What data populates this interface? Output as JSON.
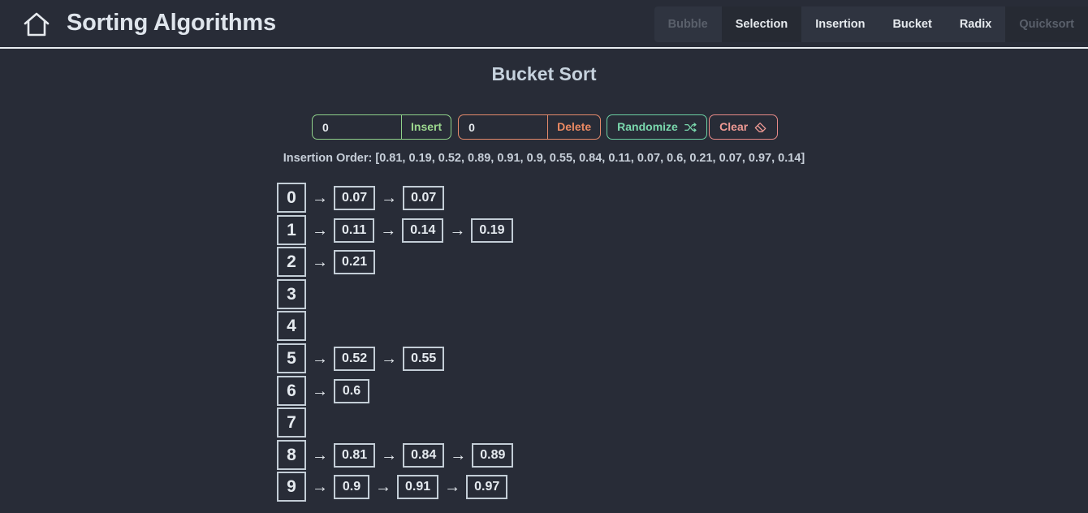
{
  "header": {
    "title": "Sorting Algorithms",
    "home_icon": "home-icon",
    "nav": [
      {
        "label": "Bubble",
        "state": "disabled"
      },
      {
        "label": "Selection",
        "state": "normal"
      },
      {
        "label": "Insertion",
        "state": "normal"
      },
      {
        "label": "Bucket",
        "state": "normal"
      },
      {
        "label": "Radix",
        "state": "normal"
      },
      {
        "label": "Quicksort",
        "state": "disabled"
      }
    ]
  },
  "main": {
    "heading": "Bucket Sort",
    "insert": {
      "value": "0",
      "label": "Insert"
    },
    "delete": {
      "value": "0",
      "label": "Delete"
    },
    "randomize": {
      "label": "Randomize",
      "icon": "shuffle-icon"
    },
    "clear": {
      "label": "Clear",
      "icon": "eraser-icon"
    },
    "insertion_order": {
      "label": "Insertion Order:",
      "values": "[0.81, 0.19, 0.52, 0.89, 0.91, 0.9, 0.55, 0.84, 0.11, 0.07, 0.6, 0.21, 0.07, 0.97, 0.14]"
    },
    "buckets": [
      {
        "index": "0",
        "items": [
          "0.07",
          "0.07"
        ]
      },
      {
        "index": "1",
        "items": [
          "0.11",
          "0.14",
          "0.19"
        ]
      },
      {
        "index": "2",
        "items": [
          "0.21"
        ]
      },
      {
        "index": "3",
        "items": []
      },
      {
        "index": "4",
        "items": []
      },
      {
        "index": "5",
        "items": [
          "0.52",
          "0.55"
        ]
      },
      {
        "index": "6",
        "items": [
          "0.6"
        ]
      },
      {
        "index": "7",
        "items": []
      },
      {
        "index": "8",
        "items": [
          "0.81",
          "0.84",
          "0.89"
        ]
      },
      {
        "index": "9",
        "items": [
          "0.9",
          "0.91",
          "0.97"
        ]
      }
    ]
  },
  "colors": {
    "background": "#282c37",
    "insert_accent": "#9dd88f",
    "delete_accent": "#ec8a63",
    "randomize_accent": "#7ad8ad",
    "clear_accent": "#ef9a94"
  }
}
